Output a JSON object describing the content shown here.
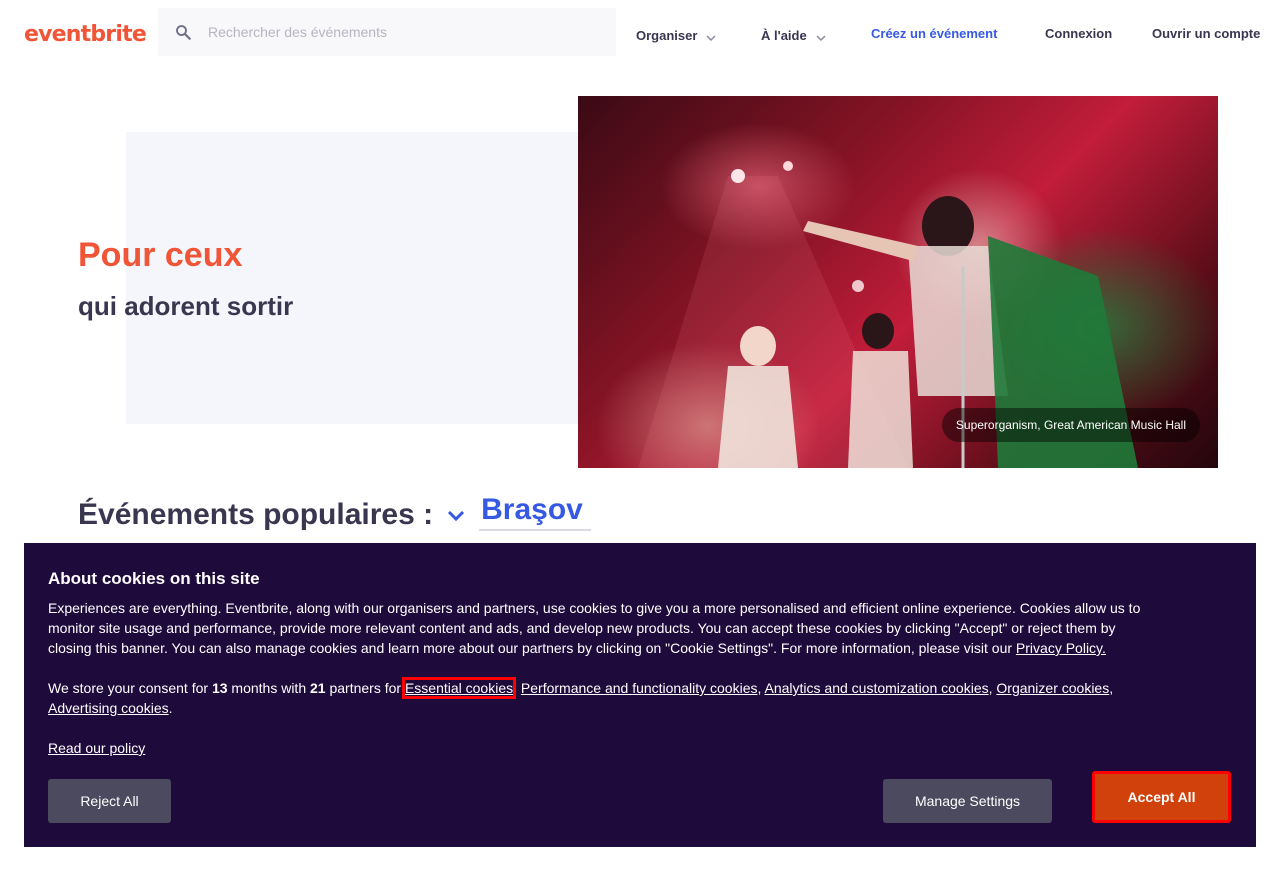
{
  "header": {
    "logo": "eventbrite",
    "search_placeholder": "Rechercher des événements",
    "nav": {
      "organize": "Organiser",
      "help": "À l'aide",
      "create_event": "Créez un événement",
      "login": "Connexion",
      "signup": "Ouvrir un compte"
    }
  },
  "hero": {
    "title": "Pour ceux",
    "subtitle": "qui adorent sortir",
    "image_caption": "Superorganism, Great American Music Hall"
  },
  "popular": {
    "title": "Événements populaires :",
    "location": "Braşov"
  },
  "cookie": {
    "title": "About cookies on this site",
    "body": "Experiences are everything. Eventbrite, along with our organisers and partners, use cookies to give you a more personalised and efficient online experience. Cookies allow us to monitor site usage and performance, provide more relevant content and ads, and develop new products. You can accept these cookies by clicking \"Accept\" or reject them by closing this banner. You can also manage cookies and learn more about our partners by clicking on \"Cookie Settings\". For more information, please visit our",
    "privacy_link": "Privacy Policy.",
    "consent_prefix": "We store your consent for",
    "months": "13",
    "months_text": "months with",
    "partners": "21",
    "partners_text": "partners for",
    "links": {
      "essential": "Essential cookies",
      "performance": "Performance and functionality cookies",
      "analytics": "Analytics and customization cookies",
      "organizer": "Organizer cookies",
      "advertising": "Advertising cookies"
    },
    "read_policy": "Read our policy",
    "reject": "Reject All",
    "manage": "Manage Settings",
    "accept": "Accept All"
  }
}
